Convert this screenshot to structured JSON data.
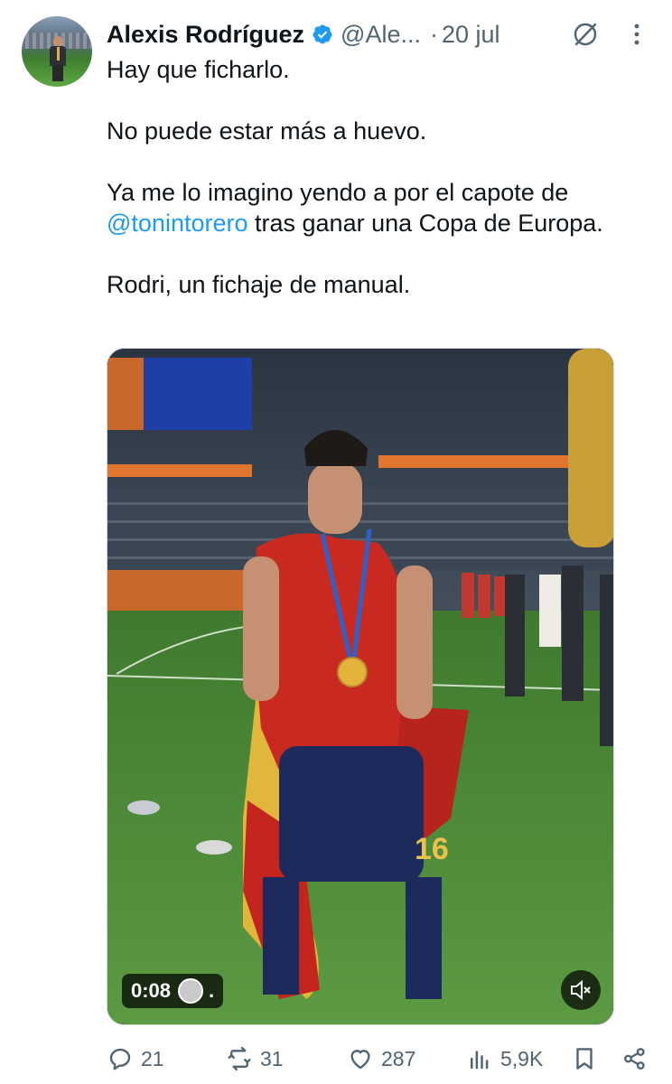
{
  "post": {
    "author_name": "Alexis Rodríguez",
    "handle": "@Ale...",
    "separator": "·",
    "date": "20 jul",
    "paragraphs": {
      "p1": "Hay que ficharlo.",
      "p2": "No puede estar más a huevo.",
      "p3_before": "Ya me lo imagino yendo a por el capote de",
      "p3_mention": "@tonintorero",
      "p3_after": "tras ganar una Copa de Europa.",
      "p4": "Rodri, un fichaje de manual."
    },
    "video": {
      "duration": "0:08",
      "dot": "."
    },
    "metrics": {
      "replies": "21",
      "reposts": "31",
      "likes": "287",
      "views": "5,9K"
    }
  },
  "colors": {
    "accent": "#1d9bf0",
    "secondary_text": "#536471",
    "primary_text": "#0f1419"
  }
}
